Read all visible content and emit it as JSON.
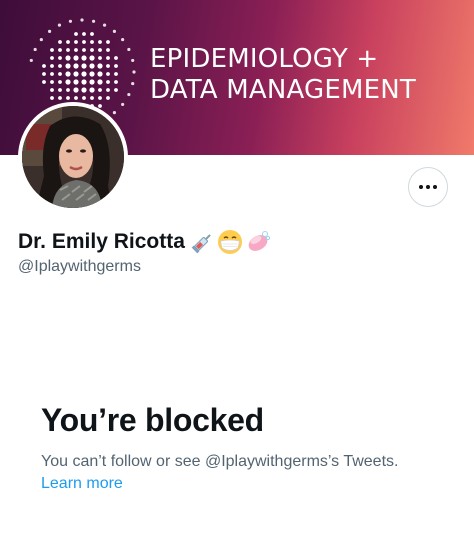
{
  "banner": {
    "line1": "EPIDEMIOLOGY +",
    "line2": "DATA MANAGEMENT"
  },
  "profile": {
    "display_name": "Dr. Emily Ricotta",
    "name_emojis": [
      "syringe-icon",
      "mask-face-icon",
      "soap-icon"
    ],
    "handle": "@Iplaywithgerms"
  },
  "more_button": {
    "icon": "more-dots-icon"
  },
  "blocked": {
    "title": "You’re blocked",
    "description": "You can’t follow or see @Iplaywithgerms’s Tweets.",
    "learn_more": "Learn more"
  },
  "colors": {
    "banner_start": "#3e0d3a",
    "banner_end": "#f07a6a",
    "text_primary": "#0f1419",
    "text_secondary": "#536471",
    "link": "#1d9bf0"
  }
}
